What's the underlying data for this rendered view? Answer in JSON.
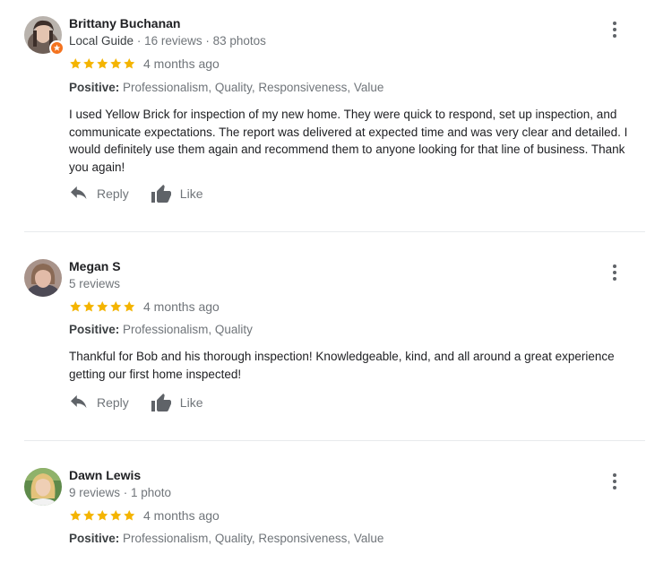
{
  "reviews": [
    {
      "name": "Brittany Buchanan",
      "local_guide": "Local Guide",
      "meta_sep": " · ",
      "meta": "16 reviews · 83 photos",
      "stars": 5,
      "date": "4 months ago",
      "positive_label": "Positive:",
      "positive": "Professionalism, Quality, Responsiveness, Value",
      "text": "I used Yellow Brick for inspection of my new home. They were quick to respond, set up inspection, and communicate expectations. The report was delivered at expected time and was very clear and detailed. I would definitely use them again and recommend them to anyone looking for that line of business. Thank you again!",
      "reply_label": "Reply",
      "like_label": "Like"
    },
    {
      "name": "Megan S",
      "meta": "5 reviews",
      "stars": 5,
      "date": "4 months ago",
      "positive_label": "Positive:",
      "positive": "Professionalism, Quality",
      "text": "Thankful for Bob and his thorough inspection! Knowledgeable, kind, and all around a great experience getting our first home inspected!",
      "reply_label": "Reply",
      "like_label": "Like"
    },
    {
      "name": "Dawn Lewis",
      "meta": "9 reviews · 1 photo",
      "stars": 5,
      "date": "4 months ago",
      "positive_label": "Positive:",
      "positive": "Professionalism, Quality, Responsiveness, Value"
    }
  ],
  "colors": {
    "star": "#f4b400",
    "badge": "#f4731f",
    "icon": "#5f6368"
  },
  "icons": {
    "reply": "reply-arrow-icon",
    "like": "thumbs-up-icon",
    "more": "more-vert-icon",
    "local_guide": "local-guide-badge-icon"
  }
}
